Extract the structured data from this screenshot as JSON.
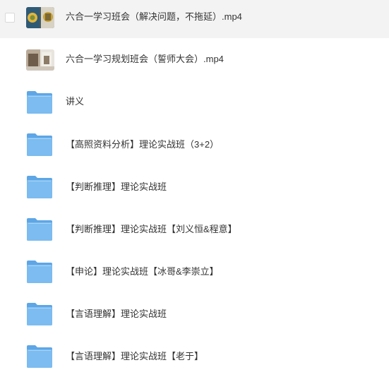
{
  "files": [
    {
      "name": "六合一学习班会（解决问题，不拖延）.mp4",
      "icon": "video-thumbnail-icon",
      "selected_hover": true
    },
    {
      "name": "六合一学习规划班会（誓师大会）.mp4",
      "icon": "video-thumbnail-icon"
    },
    {
      "name": "讲义",
      "icon": "folder-icon"
    },
    {
      "name": "【高照资料分析】理论实战班（3+2）",
      "icon": "folder-icon"
    },
    {
      "name": "【判断推理】理论实战班",
      "icon": "folder-icon"
    },
    {
      "name": "【判断推理】理论实战班【刘义恒&程意】",
      "icon": "folder-icon"
    },
    {
      "name": "【申论】理论实战班【冰哥&李崇立】",
      "icon": "folder-icon"
    },
    {
      "name": "【言语理解】理论实战班",
      "icon": "folder-icon"
    },
    {
      "name": "【言语理解】理论实战班【老于】",
      "icon": "folder-icon"
    }
  ],
  "colors": {
    "folder_front": "#7cbcf0",
    "folder_back": "#5ea6e6",
    "hover_row": "#f3f3f4",
    "text": "#333333"
  }
}
